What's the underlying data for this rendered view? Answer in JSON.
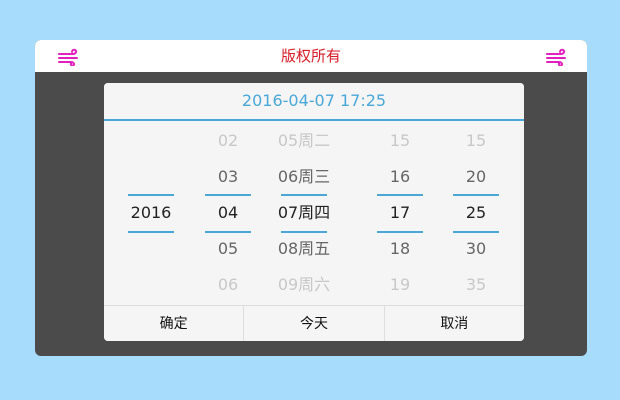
{
  "topbar": {
    "title": "版权所有",
    "left_icon": "wind-icon",
    "right_icon": "wind-icon",
    "icon_color": "#e020c0",
    "title_color": "#d81e2a"
  },
  "dialog": {
    "header_value": "2016-04-07 17:25",
    "accent_color": "#4aa8d8",
    "columns": [
      {
        "name": "year",
        "items": [
          "",
          "",
          "2016",
          "",
          ""
        ]
      },
      {
        "name": "month",
        "items": [
          "02",
          "03",
          "04",
          "05",
          "06"
        ]
      },
      {
        "name": "day",
        "items": [
          "05周二",
          "06周三",
          "07周四",
          "08周五",
          "09周六"
        ]
      },
      {
        "name": "hour",
        "items": [
          "15",
          "16",
          "17",
          "18",
          "19"
        ]
      },
      {
        "name": "minute",
        "items": [
          "15",
          "20",
          "25",
          "30",
          "35"
        ]
      }
    ],
    "buttons": {
      "confirm": "确定",
      "today": "今天",
      "cancel": "取消"
    }
  }
}
